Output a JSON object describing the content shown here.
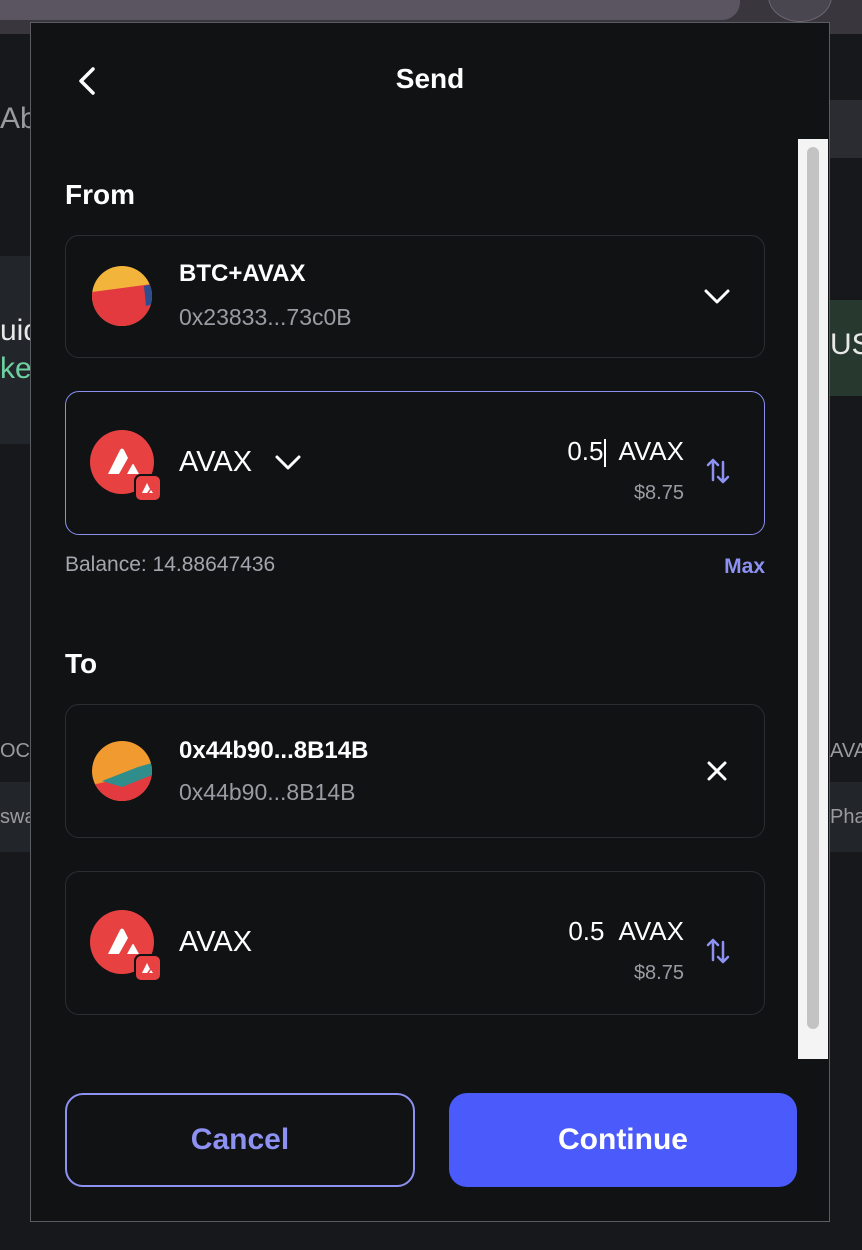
{
  "header": {
    "title": "Send"
  },
  "from": {
    "label": "From",
    "account": {
      "name": "BTC+AVAX",
      "address": "0x23833...73c0B"
    },
    "token": {
      "symbol": "AVAX",
      "amount": "0.5",
      "unit": "AVAX",
      "usd": "$8.75"
    },
    "balance": "Balance: 14.88647436",
    "max_label": "Max"
  },
  "to": {
    "label": "To",
    "account": {
      "name": "0x44b90...8B14B",
      "address": "0x44b90...8B14B"
    },
    "token": {
      "symbol": "AVAX",
      "amount": "0.5",
      "unit": "AVAX",
      "usd": "$8.75"
    }
  },
  "actions": {
    "cancel": "Cancel",
    "continue": "Continue"
  },
  "background": {
    "fragments": [
      "Abc",
      "uid",
      "ke",
      "US",
      "OC",
      "swa",
      "AVA",
      "Phar"
    ]
  },
  "colors": {
    "accent": "#4b5afb",
    "accent_light": "#8d91f2",
    "avax_red": "#e84142",
    "modal_bg": "#111214"
  },
  "icons": [
    "chevron-left-icon",
    "chevron-down-icon",
    "swap-arrows-icon",
    "close-icon",
    "avax-icon"
  ]
}
